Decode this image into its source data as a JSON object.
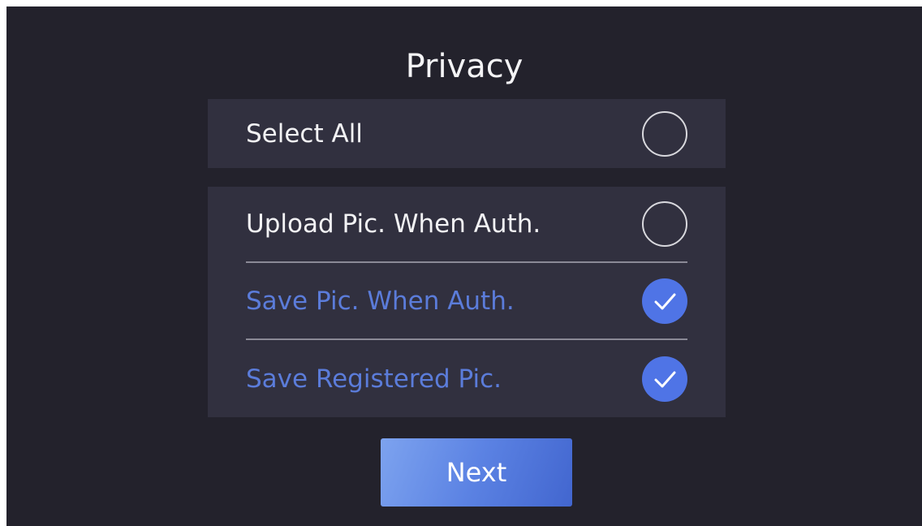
{
  "screen": {
    "title": "Privacy"
  },
  "select_all": {
    "label": "Select All",
    "checked": false
  },
  "options": [
    {
      "label": "Upload Pic. When Auth.",
      "checked": false
    },
    {
      "label": "Save Pic. When Auth.",
      "checked": true
    },
    {
      "label": "Save Registered Pic.",
      "checked": true
    }
  ],
  "next_button": {
    "label": "Next"
  },
  "colors": {
    "background": "#23222c",
    "panel": "#31303f",
    "accent": "#4f74e6",
    "checked_text": "#5b7cda"
  }
}
